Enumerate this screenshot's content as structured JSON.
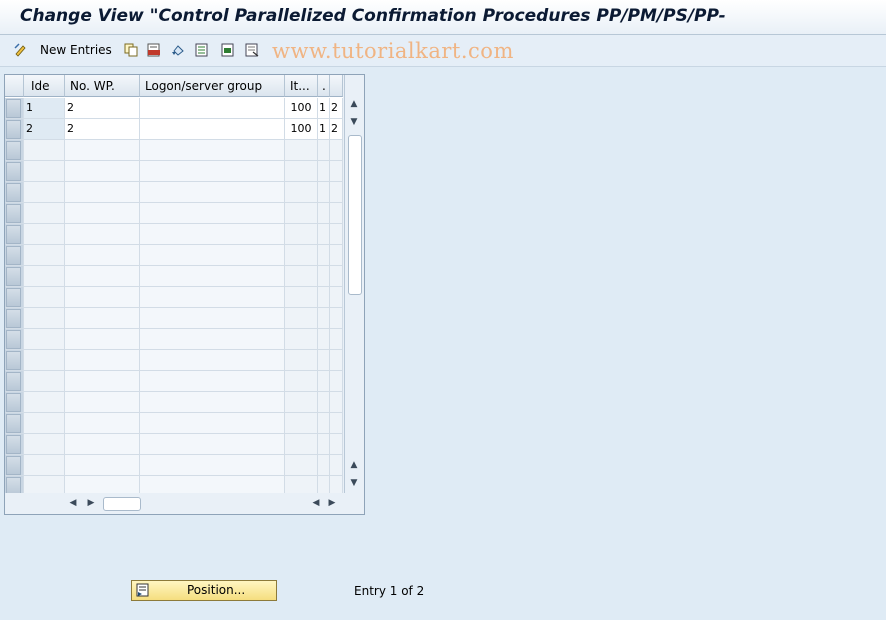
{
  "window": {
    "title": "Change View \"Control Parallelized Confirmation Procedures PP/PM/PS/PP-"
  },
  "toolbar": {
    "new_entries_label": "New Entries",
    "icons": [
      "display-change-icon",
      "copy-icon",
      "delete-icon",
      "undo-icon",
      "select-all-icon",
      "select-block-icon",
      "deselect-all-icon"
    ]
  },
  "watermark": "www.tutorialkart.com",
  "table": {
    "columns": [
      "Ide",
      "No. WP.",
      "Logon/server group",
      "It...",
      ".",
      ""
    ],
    "rows": [
      {
        "ide": "1",
        "wp": "2",
        "group": "",
        "it": "100",
        "c5": "1",
        "c6": "2"
      },
      {
        "ide": "2",
        "wp": "2",
        "group": "",
        "it": "100",
        "c5": "1",
        "c6": "2"
      }
    ]
  },
  "footer": {
    "position_label": "Position...",
    "entry_info": "Entry 1 of 2"
  }
}
